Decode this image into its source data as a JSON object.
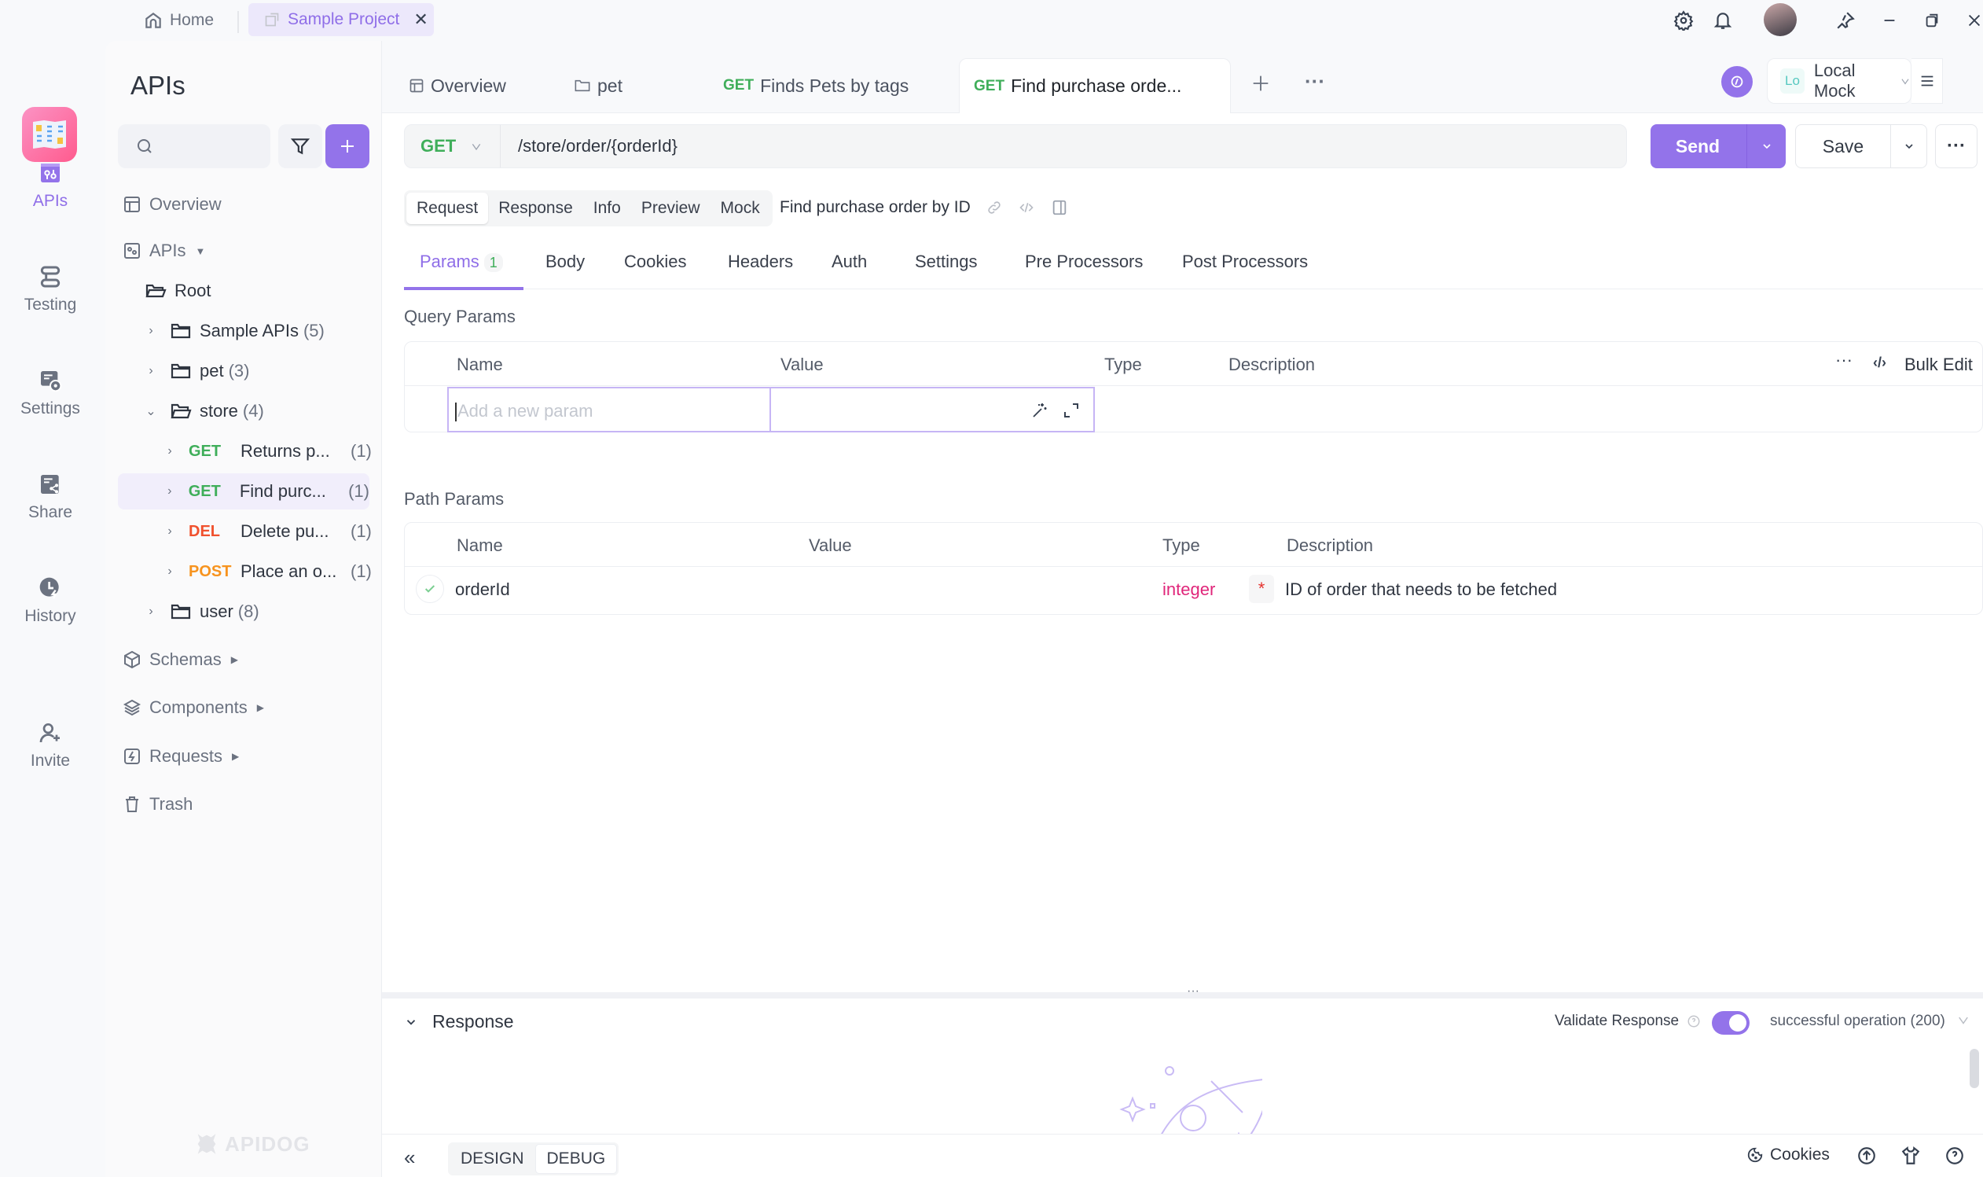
{
  "titlebar": {
    "home_label": "Home",
    "project_tab_label": "Sample Project",
    "close_glyph": "✕"
  },
  "rail": {
    "items": [
      {
        "label": "APIs",
        "icon": "apis-icon",
        "active": true
      },
      {
        "label": "Testing",
        "icon": "testing-icon"
      },
      {
        "label": "Settings",
        "icon": "settings-icon"
      },
      {
        "label": "Share",
        "icon": "share-icon"
      },
      {
        "label": "History",
        "icon": "history-icon"
      },
      {
        "label": "Invite",
        "icon": "invite-icon"
      }
    ]
  },
  "tree": {
    "title": "APIs",
    "search_placeholder": "",
    "overview": "Overview",
    "apis": "APIs",
    "root": "Root",
    "folders": [
      {
        "name": "Sample APIs",
        "count": "(5)"
      },
      {
        "name": "pet",
        "count": "(3)"
      },
      {
        "name": "store",
        "count": "(4)"
      },
      {
        "name": "user",
        "count": "(8)"
      }
    ],
    "endpoints": [
      {
        "method": "GET",
        "name": "Returns p...",
        "count": "(1)"
      },
      {
        "method": "GET",
        "name": "Find purc...",
        "count": "(1)",
        "selected": true
      },
      {
        "method": "DEL",
        "name": "Delete pu...",
        "count": "(1)"
      },
      {
        "method": "POST",
        "name": "Place an o...",
        "count": "(1)"
      }
    ],
    "schemas": "Schemas",
    "components": "Components",
    "requests": "Requests",
    "trash": "Trash",
    "brand": "APIDOG"
  },
  "tabs": [
    {
      "label": "Overview",
      "icon": "overview-icon"
    },
    {
      "label": "pet",
      "icon": "folder-icon"
    },
    {
      "method": "GET",
      "label": "Finds Pets by tags"
    },
    {
      "method": "GET",
      "label": "Find purchase orde...",
      "active": true
    }
  ],
  "env": {
    "badge": "Lo",
    "label": "Local Mock"
  },
  "request": {
    "method": "GET",
    "url": "/store/order/{orderId}",
    "send_label": "Send",
    "save_label": "Save"
  },
  "mode_tabs": [
    "Request",
    "Response",
    "Info",
    "Preview",
    "Mock"
  ],
  "api_name": "Find purchase order by ID",
  "subtabs": [
    {
      "label": "Params",
      "badge": "1",
      "active": true
    },
    {
      "label": "Body"
    },
    {
      "label": "Cookies"
    },
    {
      "label": "Headers"
    },
    {
      "label": "Auth"
    },
    {
      "label": "Settings"
    },
    {
      "label": "Pre Processors"
    },
    {
      "label": "Post Processors"
    }
  ],
  "query_params": {
    "title": "Query Params",
    "headers": [
      "Name",
      "Value",
      "Type",
      "Description"
    ],
    "bulk_edit": "Bulk Edit",
    "new_param_placeholder": "Add a new param"
  },
  "path_params": {
    "title": "Path Params",
    "headers": [
      "Name",
      "Value",
      "Type",
      "Description"
    ],
    "rows": [
      {
        "enabled": true,
        "name": "orderId",
        "value": "",
        "type": "integer",
        "required": "*",
        "description": "ID of order that needs to be fetched"
      }
    ]
  },
  "response": {
    "title": "Response",
    "validate_label": "Validate Response",
    "validate_on": true,
    "selected_response": "successful operation (200)"
  },
  "bottom": {
    "design": "DESIGN",
    "debug": "DEBUG",
    "cookies": "Cookies"
  },
  "colors": {
    "accent": "#9373ea",
    "get": "#3fae5a",
    "delete": "#f0512e",
    "post": "#f7931e",
    "type_integer": "#e0267a"
  }
}
